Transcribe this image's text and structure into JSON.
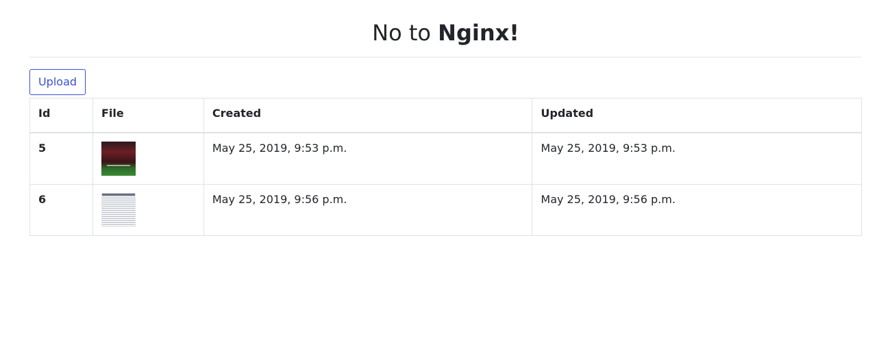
{
  "header": {
    "title_prefix": "No to",
    "title_bold": "Nginx!"
  },
  "toolbar": {
    "upload_label": "Upload"
  },
  "table": {
    "columns": [
      "Id",
      "File",
      "Created",
      "Updated"
    ],
    "rows": [
      {
        "id": "5",
        "file_icon": "image-thumbnail-stadium",
        "created": "May 25, 2019, 9:53 p.m.",
        "updated": "May 25, 2019, 9:53 p.m."
      },
      {
        "id": "6",
        "file_icon": "image-thumbnail-document",
        "created": "May 25, 2019, 9:56 p.m.",
        "updated": "May 25, 2019, 9:56 p.m."
      }
    ]
  },
  "colors": {
    "accent": "#3a4fd8",
    "text": "#212529",
    "border": "#dee2e6"
  }
}
